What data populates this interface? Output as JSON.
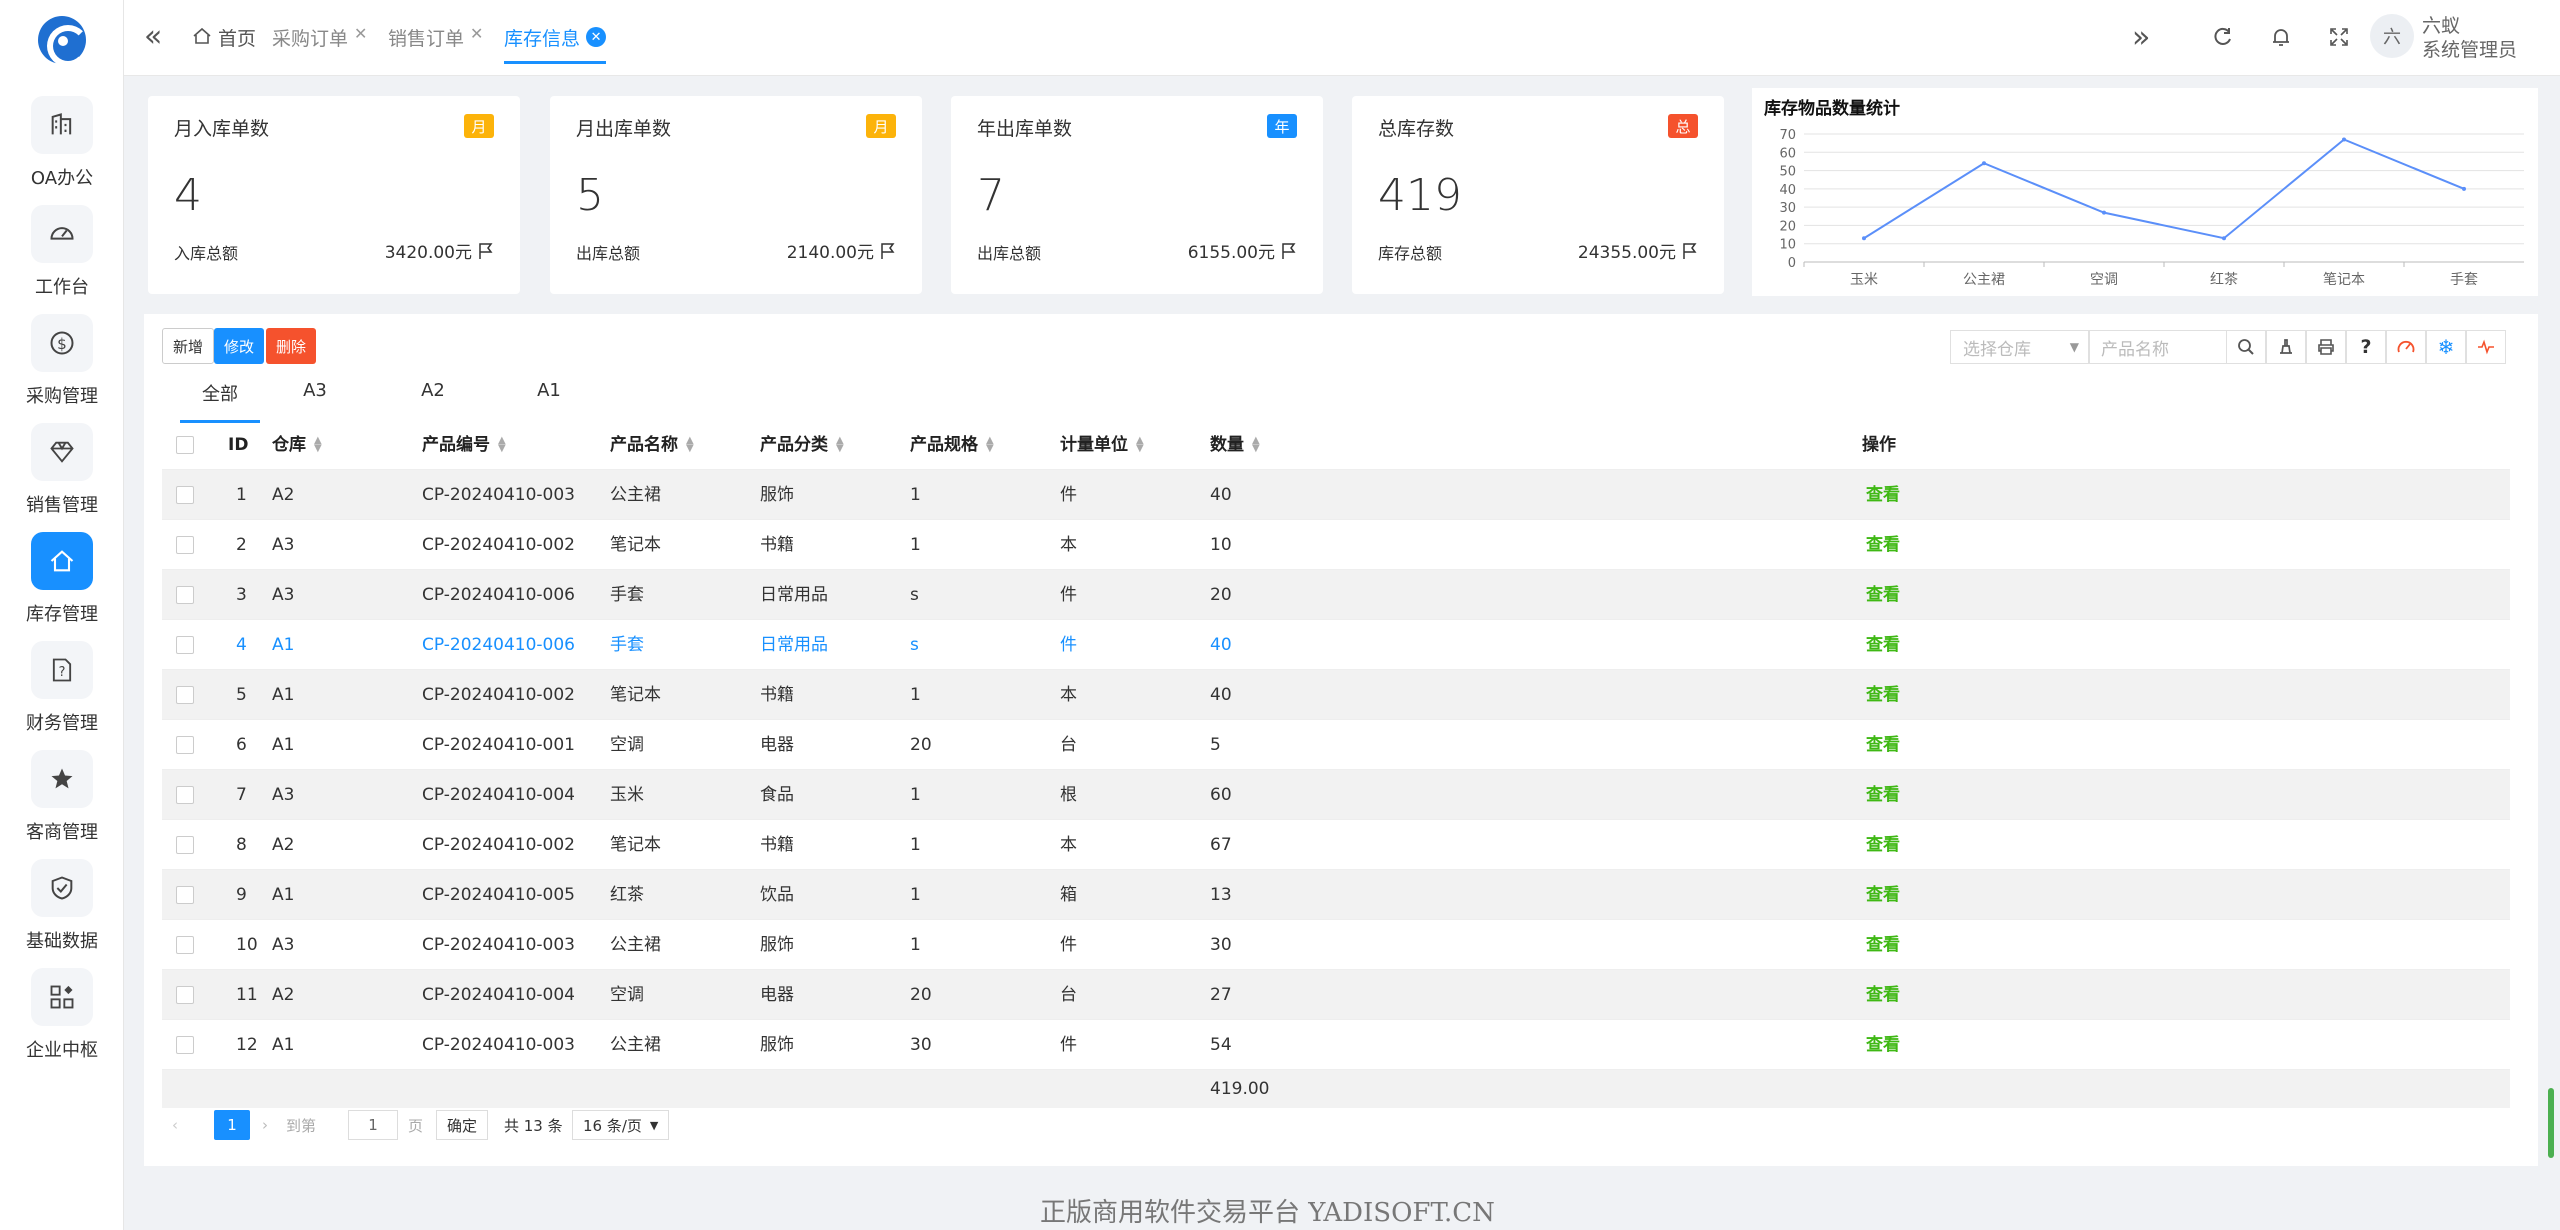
{
  "sidebar": {
    "items": [
      {
        "label": "OA办公",
        "icon": "building-icon"
      },
      {
        "label": "工作台",
        "icon": "dashboard-gauge-icon"
      },
      {
        "label": "采购管理",
        "icon": "dollar-icon"
      },
      {
        "label": "销售管理",
        "icon": "diamond-icon"
      },
      {
        "label": "库存管理",
        "icon": "home-icon"
      },
      {
        "label": "财务管理",
        "icon": "help-document-icon"
      },
      {
        "label": "客商管理",
        "icon": "star-icon"
      },
      {
        "label": "基础数据",
        "icon": "shield-check-icon"
      },
      {
        "label": "企业中枢",
        "icon": "apps-grid-icon"
      }
    ],
    "active_index": 4
  },
  "topbar": {
    "tabs": [
      {
        "label": "首页"
      },
      {
        "label": "采购订单"
      },
      {
        "label": "销售订单"
      },
      {
        "label": "库存信息"
      }
    ],
    "user": {
      "avatar_text": "六",
      "name_line1": "六蚁",
      "name_line2": "系统管理员"
    }
  },
  "stats": [
    {
      "title": "月入库单数",
      "badge": "月",
      "badge_color": "#fcb30a",
      "number": "4",
      "sub_label": "入库总额",
      "sub_value": "3420.00元"
    },
    {
      "title": "月出库单数",
      "badge": "月",
      "badge_color": "#fcb30a",
      "number": "5",
      "sub_label": "出库总额",
      "sub_value": "2140.00元"
    },
    {
      "title": "年出库单数",
      "badge": "年",
      "badge_color": "#1890ff",
      "number": "7",
      "sub_label": "出库总额",
      "sub_value": "6155.00元"
    },
    {
      "title": "总库存数",
      "badge": "总",
      "badge_color": "#f5522d",
      "number": "419",
      "sub_label": "库存总额",
      "sub_value": "24355.00元"
    }
  ],
  "chart_data": {
    "type": "line",
    "title": "库存物品数量统计",
    "categories": [
      "玉米",
      "公主裙",
      "空调",
      "红茶",
      "笔记本",
      "手套"
    ],
    "values": [
      13,
      54,
      27,
      13,
      67,
      40
    ],
    "yticks": [
      0,
      10,
      20,
      30,
      40,
      50,
      60,
      70
    ],
    "ylim": [
      0,
      70
    ],
    "grid": true,
    "color": "#5b8ff9"
  },
  "toolbar": {
    "add": "新增",
    "edit": "修改",
    "delete": "删除"
  },
  "filters": {
    "warehouse_placeholder": "选择仓库",
    "product_placeholder": "产品名称"
  },
  "subtabs": [
    "全部",
    "A3",
    "A2",
    "A1"
  ],
  "table": {
    "headers": [
      "ID",
      "仓库",
      "产品编号",
      "产品名称",
      "产品分类",
      "产品规格",
      "计量单位",
      "数量",
      "操作"
    ],
    "action_label": "查看",
    "rows": [
      [
        "1",
        "A2",
        "CP-20240410-003",
        "公主裙",
        "服饰",
        "1",
        "件",
        "40"
      ],
      [
        "2",
        "A3",
        "CP-20240410-002",
        "笔记本",
        "书籍",
        "1",
        "本",
        "10"
      ],
      [
        "3",
        "A3",
        "CP-20240410-006",
        "手套",
        "日常用品",
        "s",
        "件",
        "20"
      ],
      [
        "4",
        "A1",
        "CP-20240410-006",
        "手套",
        "日常用品",
        "s",
        "件",
        "40"
      ],
      [
        "5",
        "A1",
        "CP-20240410-002",
        "笔记本",
        "书籍",
        "1",
        "本",
        "40"
      ],
      [
        "6",
        "A1",
        "CP-20240410-001",
        "空调",
        "电器",
        "20",
        "台",
        "5"
      ],
      [
        "7",
        "A3",
        "CP-20240410-004",
        "玉米",
        "食品",
        "1",
        "根",
        "60"
      ],
      [
        "8",
        "A2",
        "CP-20240410-002",
        "笔记本",
        "书籍",
        "1",
        "本",
        "67"
      ],
      [
        "9",
        "A1",
        "CP-20240410-005",
        "红茶",
        "饮品",
        "1",
        "箱",
        "13"
      ],
      [
        "10",
        "A3",
        "CP-20240410-003",
        "公主裙",
        "服饰",
        "1",
        "件",
        "30"
      ],
      [
        "11",
        "A2",
        "CP-20240410-004",
        "空调",
        "电器",
        "20",
        "台",
        "27"
      ],
      [
        "12",
        "A1",
        "CP-20240410-003",
        "公主裙",
        "服饰",
        "30",
        "件",
        "54"
      ]
    ],
    "highlight_row": 3,
    "total": "419.00"
  },
  "pagination": {
    "current": "1",
    "goto_label": "到第",
    "goto_value": "1",
    "page_label": "页",
    "confirm": "确定",
    "total": "共 13 条",
    "per_page": "16 条/页"
  },
  "footer": "正版商用软件交易平台 YADISOFT.CN"
}
